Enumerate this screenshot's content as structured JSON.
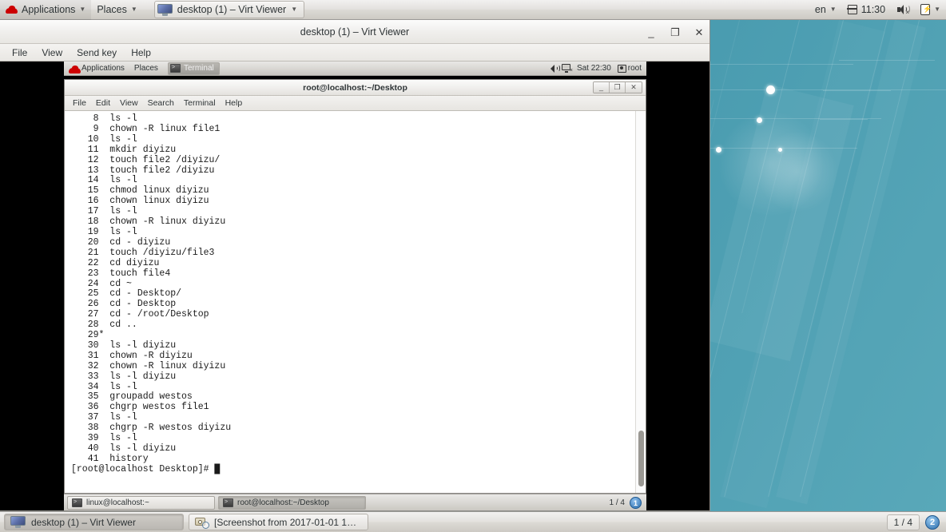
{
  "host_panel": {
    "applications_label": "Applications",
    "places_label": "Places",
    "window_button_label": "desktop (1) – Virt Viewer",
    "language_label": "en",
    "clock_label": "11:30",
    "caret_glyph": "▼"
  },
  "virt_viewer": {
    "title": "desktop (1) – Virt Viewer",
    "menus": [
      "File",
      "View",
      "Send key",
      "Help"
    ],
    "controls": {
      "minimize": "_",
      "maximize": "❐",
      "close": "✕"
    }
  },
  "guest_panel": {
    "applications_label": "Applications",
    "places_label": "Places",
    "window_button_label": "Terminal",
    "clock_label": "Sat 22:30",
    "user_label": "root"
  },
  "terminal": {
    "title": "root@localhost:~/Desktop",
    "menus": [
      "File",
      "Edit",
      "View",
      "Search",
      "Terminal",
      "Help"
    ],
    "controls": {
      "minimize": "_",
      "maximize": "❐",
      "close": "✕"
    },
    "history": [
      "    8  ls -l",
      "    9  chown -R linux file1",
      "   10  ls -l",
      "   11  mkdir diyizu",
      "   12  touch file2 /diyizu/",
      "   13  touch file2 /diyizu",
      "   14  ls -l",
      "   15  chmod linux diyizu",
      "   16  chown linux diyizu",
      "   17  ls -l",
      "   18  chown -R linux diyizu",
      "   19  ls -l",
      "   20  cd - diyizu",
      "   21  touch /diyizu/file3",
      "   22  cd diyizu",
      "   23  touch file4",
      "   24  cd ~",
      "   25  cd - Desktop/",
      "   26  cd - Desktop",
      "   27  cd - /root/Desktop",
      "   28  cd ..",
      "   29*",
      "   30  ls -l diyizu",
      "   31  chown -R diyizu",
      "   32  chown -R linux diyizu",
      "   33  ls -l diyizu",
      "   34  ls -l",
      "   35  groupadd westos",
      "   36  chgrp westos file1",
      "   37  ls -l",
      "   38  chgrp -R westos diyizu",
      "   39  ls -l",
      "   40  ls -l diyizu",
      "   41  history"
    ],
    "prompt": "[root@localhost Desktop]# ",
    "cursor": "█"
  },
  "guest_taskbar": {
    "buttons": [
      {
        "label": "linux@localhost:~",
        "active": false
      },
      {
        "label": "root@localhost:~/Desktop",
        "active": true
      }
    ],
    "workspace_label": "1 / 4",
    "badge_count": "1"
  },
  "host_taskbar": {
    "buttons": [
      {
        "label": "desktop (1) – Virt Viewer",
        "active": true
      },
      {
        "label": "[Screenshot from 2017-01-01 1…",
        "active": false
      }
    ],
    "workspace_label": "1 / 4",
    "badge_count": "2"
  },
  "colors": {
    "wallpaper_teal": "#3d90a5",
    "panel_gray": "#dcdad5",
    "badge_blue": "#2b6dab",
    "terminal_bg": "#ffffff",
    "terminal_fg": "#1a1a1a"
  }
}
